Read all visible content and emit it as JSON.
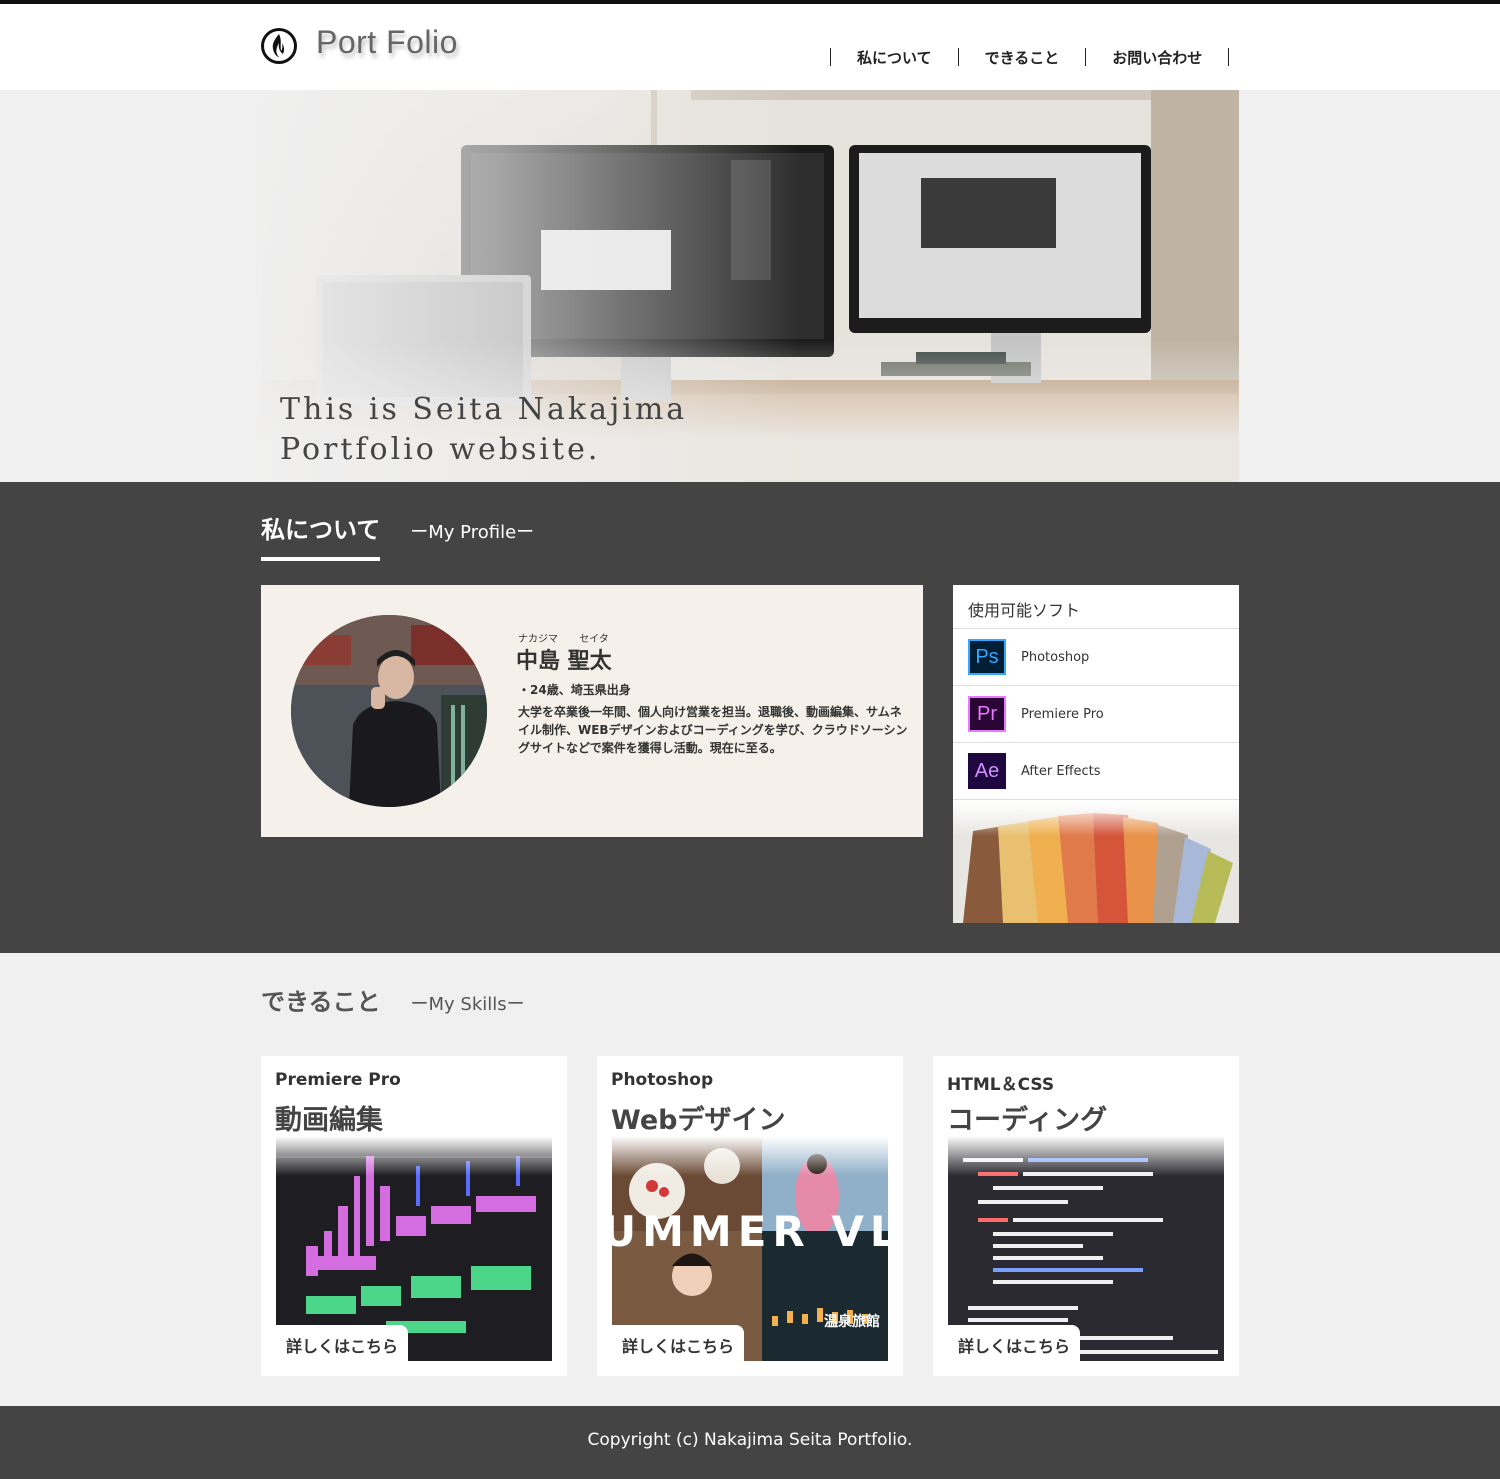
{
  "header": {
    "logo_text": "Port Folio",
    "nav": [
      "私について",
      "できること",
      "お問い合わせ"
    ]
  },
  "hero": {
    "line1": "This is Seita Nakajima",
    "line2": "Portfolio website."
  },
  "profile": {
    "title": "私について",
    "subtitle": "ーMy Profileー",
    "ruby_family": "ナカジマ",
    "ruby_given": "セイタ",
    "name": "中島 聖太",
    "bullet": "・24歳、埼玉県出身",
    "description": "大学を卒業後一年間、個人向け営業を担当。退職後、動画編集、サムネイル制作、WEBデザインおよびコーディングを学び、クラウドソーシングサイトなどで案件を獲得し活動。現在に至る。"
  },
  "software": {
    "title": "使用可能ソフト",
    "items": [
      {
        "abbr": "Ps",
        "label": "Photoshop",
        "color": "#31a8ff",
        "bg": "#001e36"
      },
      {
        "abbr": "Pr",
        "label": "Premiere Pro",
        "color": "#ea77ff",
        "bg": "#2a0634"
      },
      {
        "abbr": "Ae",
        "label": "After Effects",
        "color": "#d291ff",
        "bg": "#1f0740"
      }
    ]
  },
  "skills": {
    "title": "できること",
    "subtitle": "ーMy Skillsー",
    "cards": [
      {
        "tool": "Premiere Pro",
        "name": "動画編集",
        "button": "詳しくはこちら"
      },
      {
        "tool": "Photoshop",
        "name": "Webデザイン",
        "button": "詳しくはこちら",
        "image_text_1": "UMMER VLO",
        "image_text_2": "温泉旅館"
      },
      {
        "tool": "HTML＆CSS",
        "name": "コーディング",
        "button": "詳しくはこちら"
      }
    ]
  },
  "footer": {
    "copyright": "Copyright (c) Nakajima Seita Portfolio."
  }
}
